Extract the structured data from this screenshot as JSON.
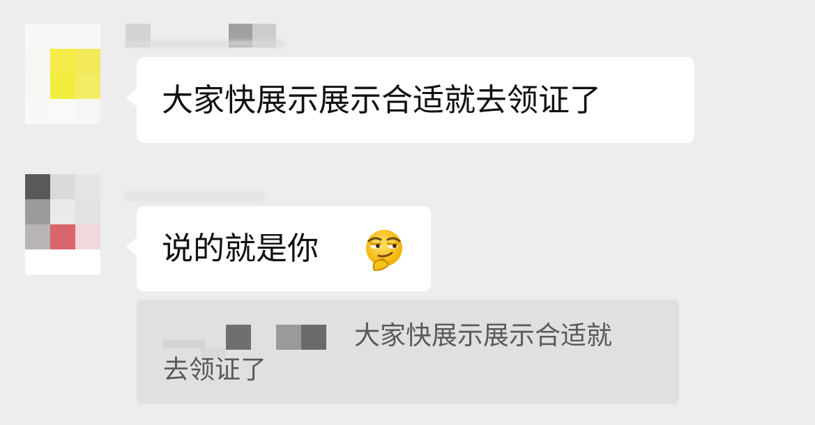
{
  "messages": [
    {
      "text": "大家快展示展示合适就去领证了",
      "avatar_colors": [
        "#f8f8f8",
        "#f8f8f8",
        "#f8f8f8",
        "#f6f6f3",
        "#f5ec4a",
        "#f2ea5a",
        "#f7f7f4",
        "#f2ec3e",
        "#f3ed66",
        "#f8f8f8",
        "#f9f9f9",
        "#f6f6f6"
      ]
    },
    {
      "text": "说的就是你",
      "emoji": "thinking-smirk-face",
      "avatar_colors": [
        "#595959",
        "#dadada",
        "#e4e4e4",
        "#9b9b9b",
        "#eaeaea",
        "#e2e2e2",
        "#b8b3b4",
        "#d9666c",
        "#f1d8dc",
        "#ffffff",
        "#ffffff",
        "#ffffff"
      ]
    }
  ],
  "quote": {
    "text_line1": "大家快展示展示合适就",
    "text_line2": "去领证了"
  },
  "colors": {
    "background": "#ededed",
    "bubble": "#ffffff",
    "quote_background": "#e0e0e0",
    "quote_text": "#5a5a5a"
  }
}
